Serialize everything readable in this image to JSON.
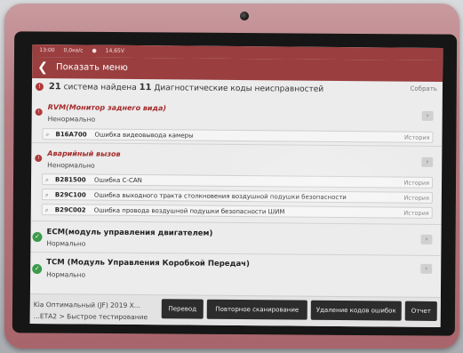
{
  "statusbar": {
    "time": "13:00",
    "net": "0,0кв/с",
    "battery_icon": "battery-icon",
    "voltage": "14,65V"
  },
  "header": {
    "back_icon": "chevron-left-icon",
    "title": "Показать меню"
  },
  "summary": {
    "count_systems": "21",
    "systems_text": "система найдена",
    "count_codes": "11",
    "codes_text": "Диагностические коды неисправностей",
    "right_label": "Собрать"
  },
  "sections": [
    {
      "name": "RVM(Монитор заднего вида)",
      "status": "Ненормально",
      "codes": [
        {
          "code": "B16A700",
          "desc": "Ошибка видеовывода камеры",
          "history": "История"
        }
      ]
    },
    {
      "name": "Аварийный вызов",
      "status": "Ненормально",
      "codes": [
        {
          "code": "B281500",
          "desc": "Ошибка C-CAN",
          "history": "История"
        },
        {
          "code": "B29C100",
          "desc": "Ошибка выходного тракта столкновения воздушной подушки безопасности",
          "history": "История"
        },
        {
          "code": "B29C002",
          "desc": "Ошибка провода воздушной подушки безопасности ШИМ",
          "history": "История"
        }
      ]
    },
    {
      "name": "ECM(модуль управления двигателем)",
      "status": "Нормально",
      "codes": []
    },
    {
      "name": "TCM (Модуль Управления Коробкой Передач)",
      "status": "Нормально",
      "codes": []
    }
  ],
  "bottom": {
    "crumb_line1": "Kia Оптимальный (JF) 2019 X...",
    "crumb_line2": "...ЕТА2 > Быстрое тестирование",
    "buttons": [
      "Перевод",
      "Повторное сканирование",
      "Удаление кодов ошибок",
      "Отчет"
    ]
  },
  "colors": {
    "accent": "#9a3e3f",
    "error": "#b03a3a",
    "ok": "#3a9b4a",
    "button": "#2c2c2c"
  }
}
